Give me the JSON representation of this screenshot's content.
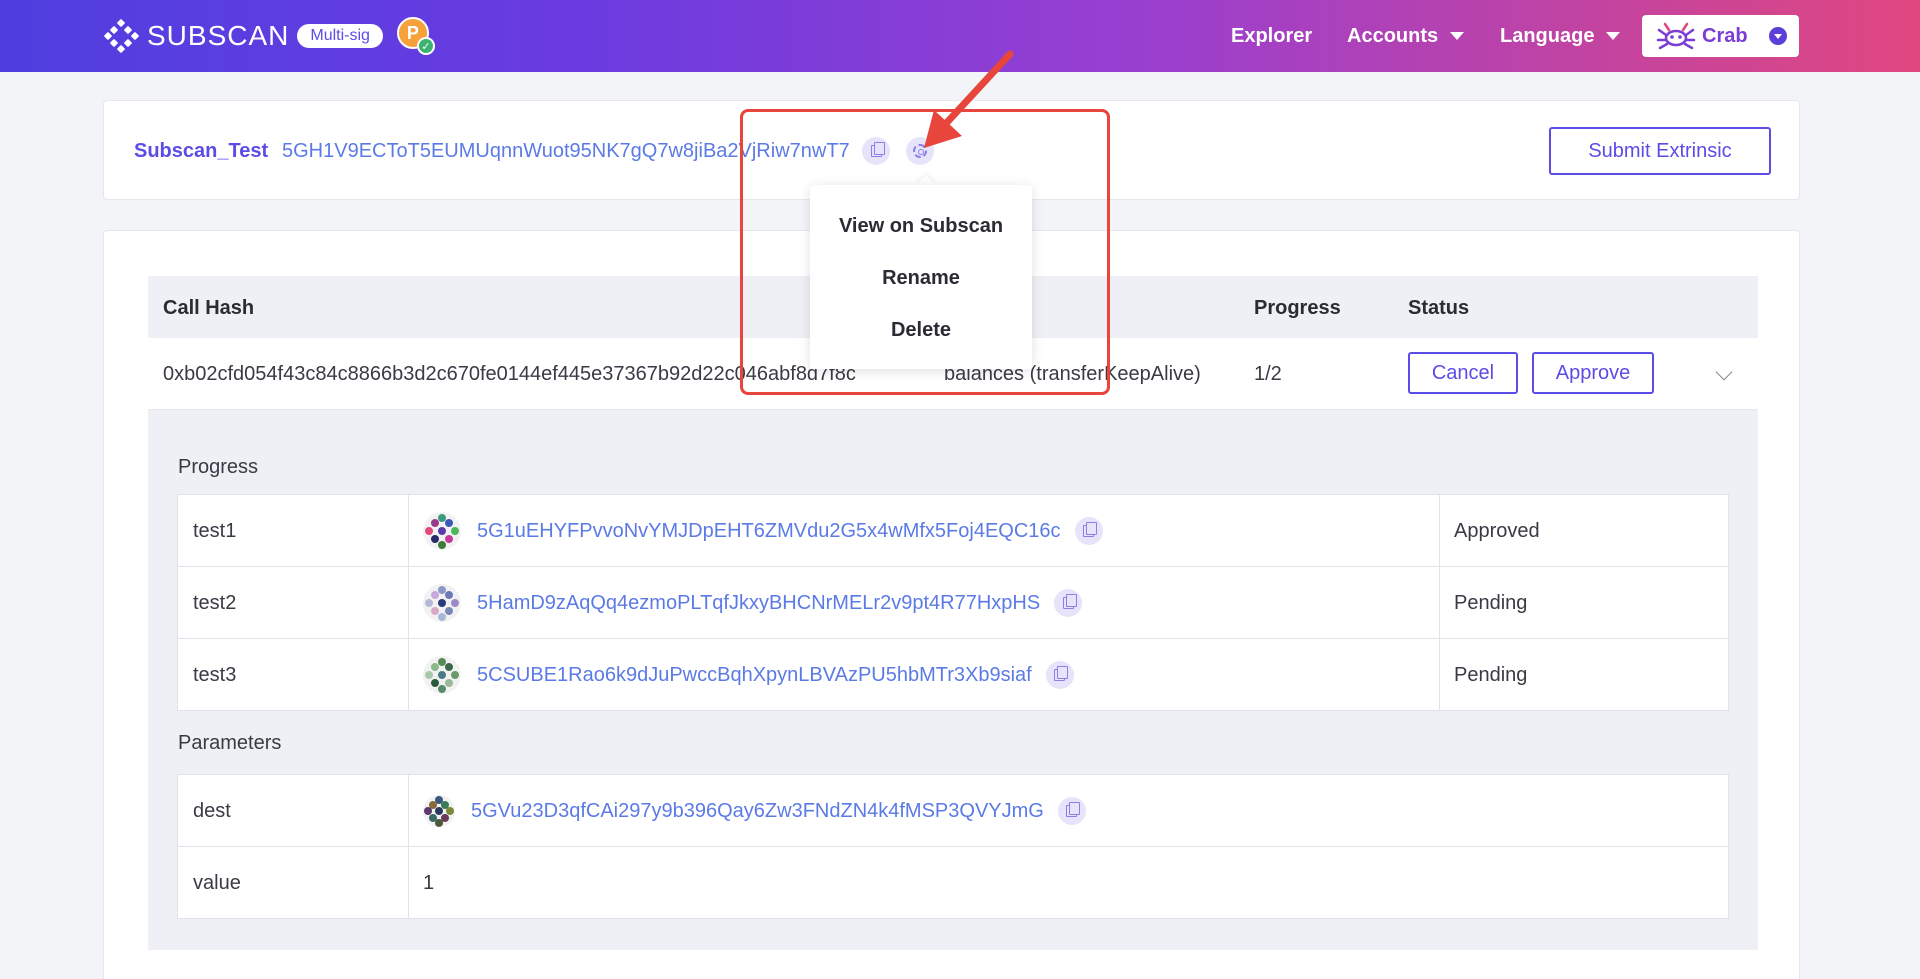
{
  "header": {
    "brand": "SUBSCAN",
    "badge": "Multi-sig",
    "network_icon": "polkadot-icon",
    "nav": {
      "explorer": "Explorer",
      "accounts": "Accounts",
      "language": "Language",
      "network": "Crab"
    }
  },
  "account": {
    "name": "Subscan_Test",
    "address": "5GH1V9ECToT5EUMUqnnWuot95NK7gQ7w8jiBa2VjRiw7nwT7",
    "submit_label": "Submit Extrinsic"
  },
  "menu": {
    "items": [
      "View on Subscan",
      "Rename",
      "Delete"
    ]
  },
  "table": {
    "headers": {
      "call_hash": "Call Hash",
      "progress": "Progress",
      "status": "Status"
    },
    "row": {
      "call_hash": "0xb02cfd054f43c84c8866b3d2c670fe0144ef445e37367b92d22c046abf8d7f8c",
      "action": "balances (transferKeepAlive)",
      "progress": "1/2",
      "cancel_label": "Cancel",
      "approve_label": "Approve"
    }
  },
  "detail": {
    "progress_title": "Progress",
    "signers": [
      {
        "name": "test1",
        "address": "5G1uEHYFPvvoNvYMJDpEHT6ZMVdu2G5x4wMfx5Foj4EQC16c",
        "status": "Approved"
      },
      {
        "name": "test2",
        "address": "5HamD9zAqQq4ezmoPLTqfJkxyBHCNrMELr2v9pt4R77HxpHS",
        "status": "Pending"
      },
      {
        "name": "test3",
        "address": "5CSUBE1Rao6k9dJuPwccBqhXpynLBVAzPU5hbMTr3Xb9siaf",
        "status": "Pending"
      }
    ],
    "parameters_title": "Parameters",
    "parameters": [
      {
        "name": "dest",
        "value": "5GVu23D3qfCAi297y9b396Qay6Zw3FNdZN4k4fMSP3QVYJmG"
      },
      {
        "name": "value",
        "value": "1"
      }
    ]
  },
  "colors": {
    "accent": "#5b4ce6",
    "link": "#5b7ae6",
    "highlight": "#e8453c"
  }
}
